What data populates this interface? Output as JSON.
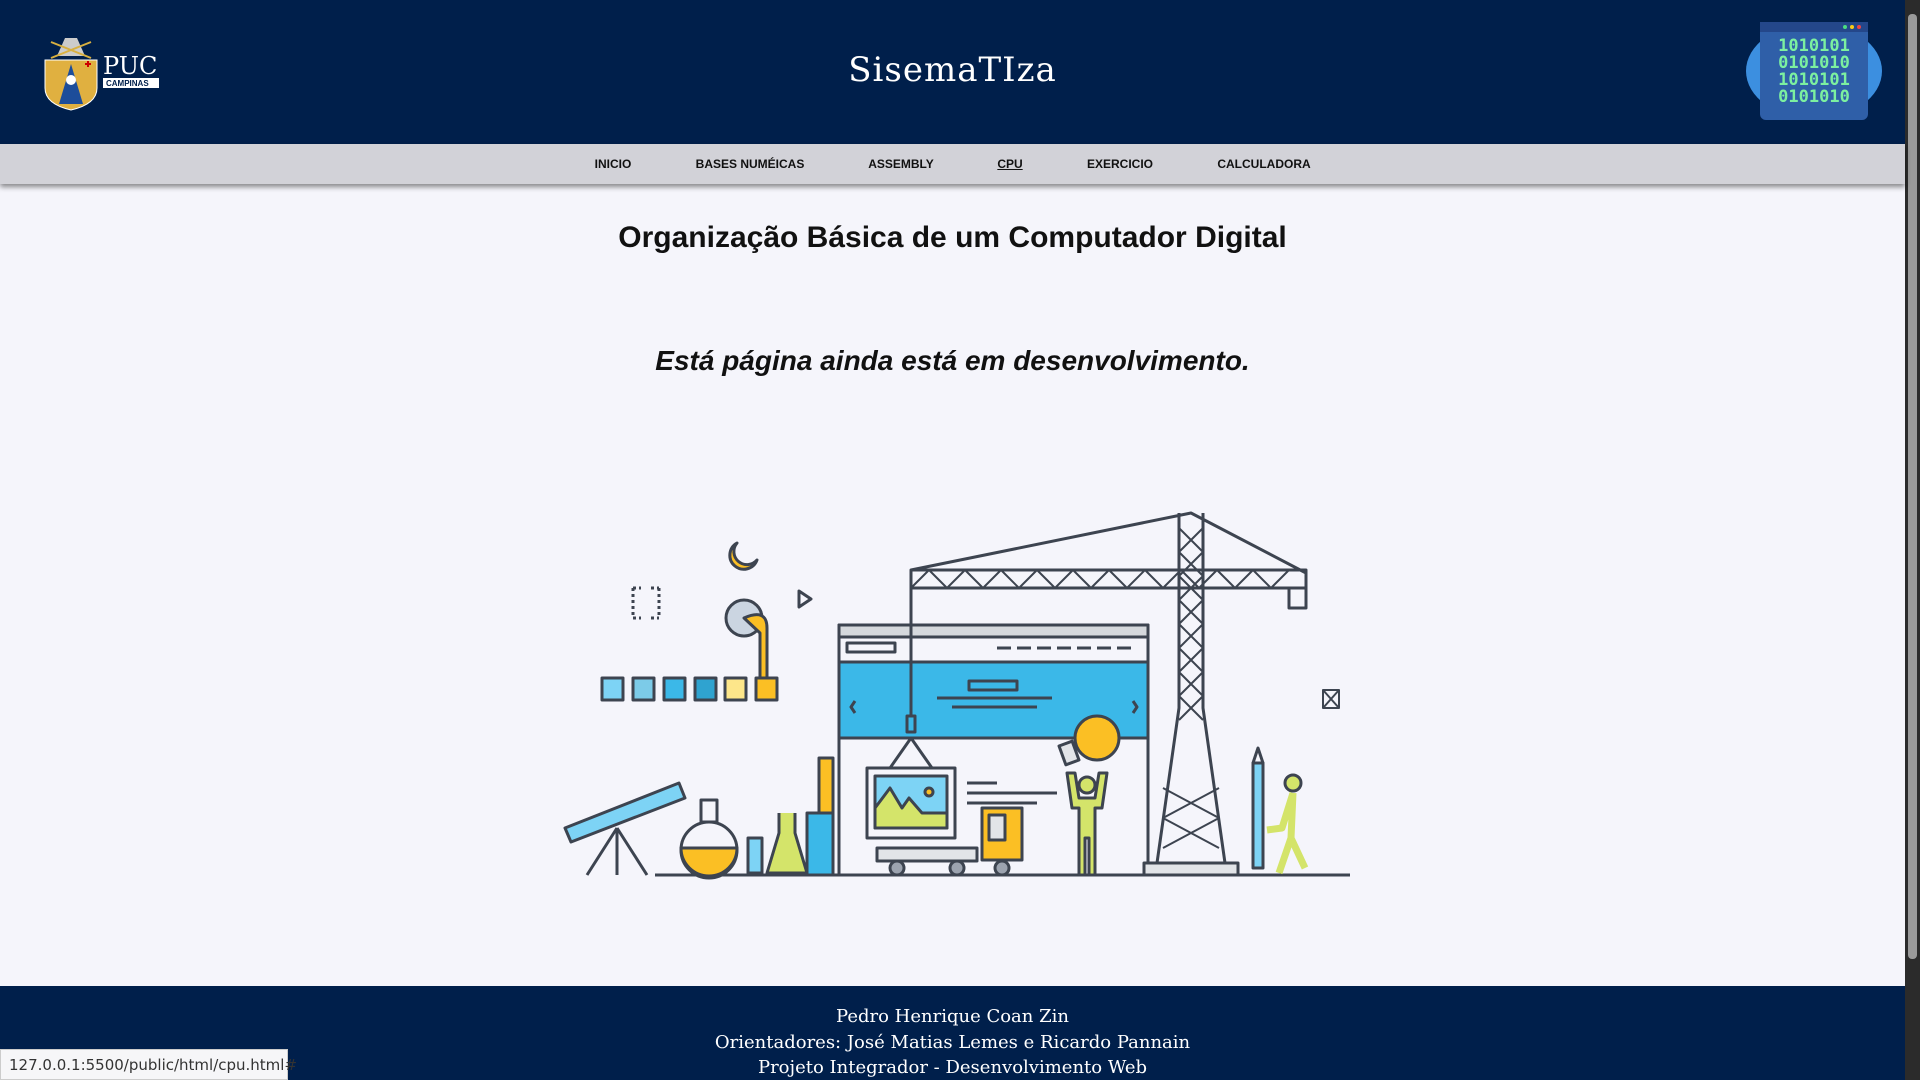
{
  "header": {
    "title": "SisemaTIza",
    "logo_left_text": "PUC",
    "logo_left_sub": "CAMPINAS",
    "logo_right_lines": [
      "1010101",
      "0101010",
      "1010101",
      "0101010"
    ]
  },
  "nav": {
    "items": [
      {
        "label": "INICIO"
      },
      {
        "label": "BASES NUMÉICAS"
      },
      {
        "label": "ASSEMBLY"
      },
      {
        "label": "CPU",
        "active": true
      },
      {
        "label": "EXERCICIO"
      },
      {
        "label": "CALCULADORA"
      }
    ]
  },
  "main": {
    "title": "Organização Básica de um Computador Digital",
    "subtitle": "Está página ainda está em desenvolvimento."
  },
  "footer": {
    "author": "Pedro Henrique Coan Zin",
    "advisors": "Orientadores: José Matias Lemes e Ricardo Pannain",
    "project": "Projeto Integrador - Desenvolvimento Web"
  },
  "status_bar": {
    "url": "127.0.0.1:5500/public/html/cpu.html#"
  },
  "colors": {
    "header_bg": "#001f4b",
    "nav_bg": "#d2d2d8",
    "accent_blue": "#3bb8e8",
    "accent_yellow": "#fbbf24",
    "accent_green": "#d4e46a"
  }
}
